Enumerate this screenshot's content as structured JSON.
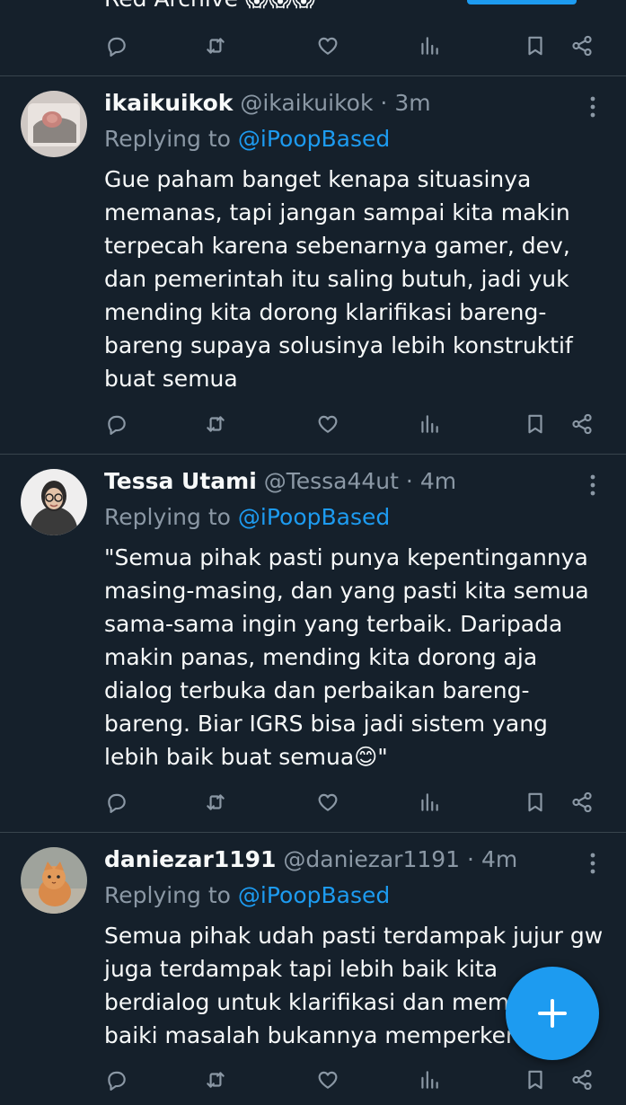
{
  "top_cutoff": {
    "text": "Red Archive 😱😱😱"
  },
  "tweets": [
    {
      "display_name": "ikaikuikok",
      "handle": "@ikaikuikok",
      "separator": "·",
      "time": "3m",
      "replying_prefix": "Replying to",
      "replying_to": "@iPoopBased",
      "text": "Gue paham banget kenapa situasinya memanas, tapi jangan sampai kita makin terpecah karena sebenarnya gamer, dev, dan pemerintah itu saling butuh, jadi yuk mending kita dorong klarifikasi bareng-bareng supaya solusinya lebih konstruktif buat semua"
    },
    {
      "display_name": "Tessa Utami",
      "handle": "@Tessa44ut",
      "separator": "·",
      "time": "4m",
      "replying_prefix": "Replying to",
      "replying_to": "@iPoopBased",
      "text": "\"Semua pihak pasti punya kepentingannya masing-masing, dan yang pasti kita semua sama-sama ingin yang terbaik. Daripada makin panas, mending kita dorong aja dialog terbuka dan perbaikan bareng-bareng. Biar IGRS bisa jadi sistem yang lebih baik buat semua😊\""
    },
    {
      "display_name": "daniezar1191",
      "handle": "@daniezar1191",
      "separator": "·",
      "time": "4m",
      "replying_prefix": "Replying to",
      "replying_to": "@iPoopBased",
      "text": "Semua pihak udah pasti terdampak jujur gw juga terdampak tapi lebih baik kita berdialog untuk klarifikasi dan memper baiki masalah bukannya memperkeruh"
    }
  ],
  "icons": {
    "reply": "reply-icon",
    "retweet": "retweet-icon",
    "like": "like-icon",
    "views": "views-icon",
    "bookmark": "bookmark-icon",
    "share": "share-icon",
    "more": "more-icon",
    "compose": "compose-icon"
  },
  "colors": {
    "background": "#15202b",
    "accent": "#1d9bf0",
    "secondary_text": "#8b98a5",
    "divider": "#38444d"
  }
}
